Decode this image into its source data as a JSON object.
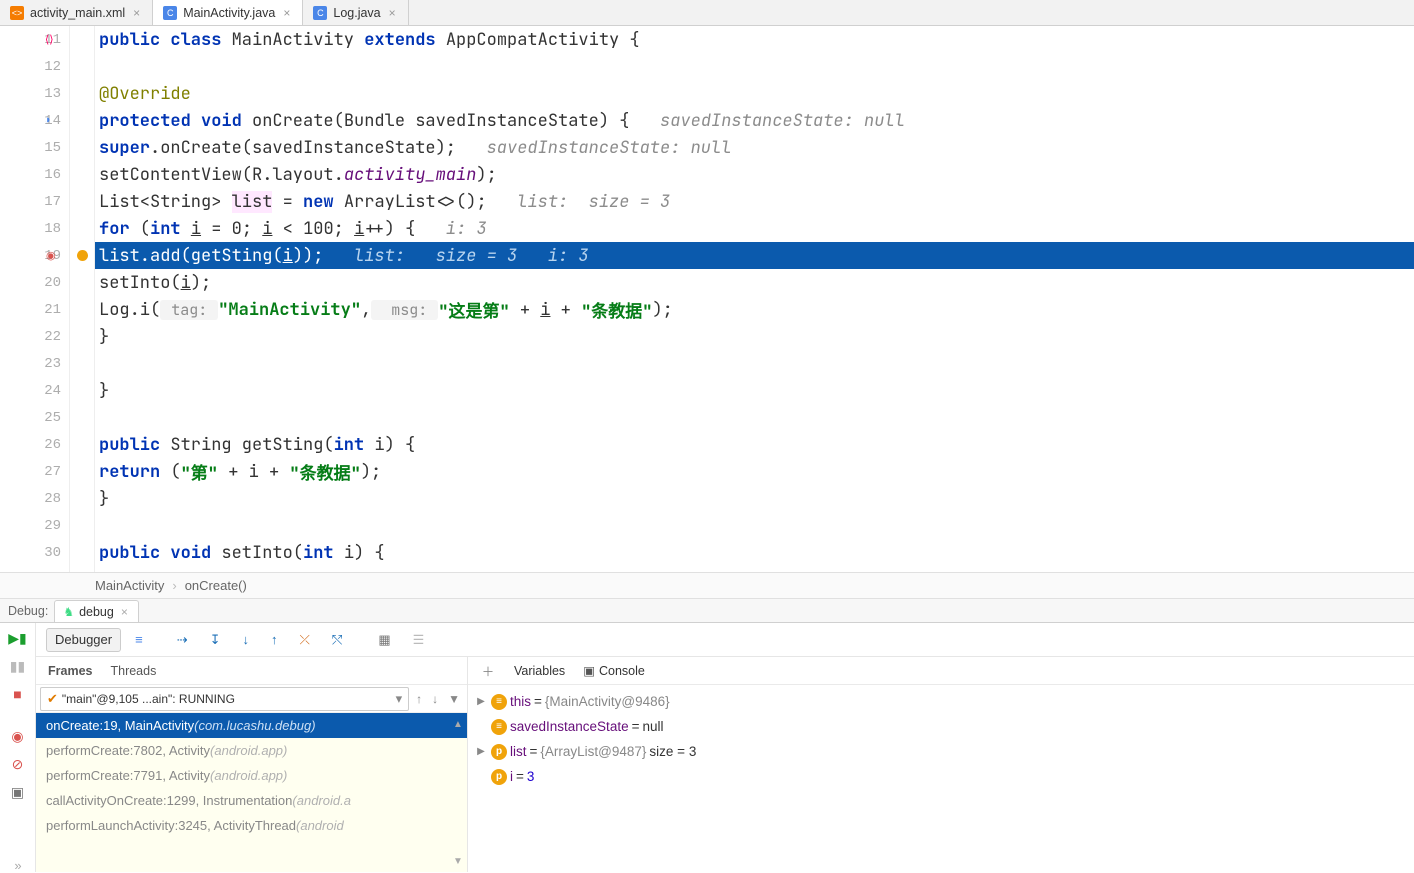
{
  "tabs": [
    {
      "name": "activity_main.xml",
      "icon": "xml"
    },
    {
      "name": "MainActivity.java",
      "icon": "java"
    },
    {
      "name": "Log.java",
      "icon": "java"
    }
  ],
  "activeTab": 1,
  "gutter": {
    "start": 11,
    "end": 30,
    "current": 19,
    "breakpoint": 19
  },
  "code": {
    "l11": {
      "k1": "public class",
      "c1": " MainActivity ",
      "k2": "extends",
      "c2": " AppCompatActivity {"
    },
    "l13": {
      "a": "@Override"
    },
    "l14": {
      "k1": "protected void",
      "m": " onCreate",
      "p": "(Bundle savedInstanceState) {",
      "h": "   savedInstanceState: null"
    },
    "l15": {
      "k": "super",
      "c": ".onCreate(savedInstanceState);",
      "h": "   savedInstanceState: null"
    },
    "l16": {
      "c": "setContentView(R.layout.",
      "f": "activity_main",
      "e": ");"
    },
    "l17": {
      "c1": "List<String> ",
      "v": "list",
      "c2": " = ",
      "k": "new",
      "c3": " ArrayList<>();",
      "h": "   list:  size = 3"
    },
    "l18": {
      "k1": "for",
      "c1": " (",
      "k2": "int",
      "c2": " ",
      "u": "i",
      "c3": " = ",
      "n": "0",
      "c4": "; ",
      "u2": "i",
      "c5": " < ",
      "n2": "100",
      "c6": "; ",
      "u3": "i",
      "c7": "++) {",
      "h": "   i: 3"
    },
    "l19": {
      "c": "list.add(getSting(",
      "u": "i",
      "e": "));",
      "h1": "   list:",
      "h2": "   size = 3",
      "h3": "   i: 3"
    },
    "l20": {
      "c": "setInto(",
      "u": "i",
      "e": ");"
    },
    "l21": {
      "c": "Log.i(",
      "t1": " tag: ",
      "s1": "\"MainActivity\"",
      "c2": ",",
      "t2": "  msg: ",
      "s2": "\"这是第\"",
      "c3": " + ",
      "u": "i",
      "c4": " + ",
      "s3": "\"条教据\"",
      "e": ");"
    },
    "l22": {
      "c": "}"
    },
    "l24": {
      "c": "}"
    },
    "l26": {
      "k1": "public",
      "c1": " String getSting(",
      "k2": "int",
      "c2": " i) {"
    },
    "l27": {
      "k": "return",
      "c1": " (",
      "s1": "\"第\"",
      "c2": " + i + ",
      "s2": "\"条教据\"",
      "c3": ");"
    },
    "l28": {
      "c": "}"
    },
    "l30": {
      "k1": "public void",
      "c1": " setInto(",
      "k2": "int",
      "c2": " i) {"
    }
  },
  "breadcrumb": {
    "a": "MainActivity",
    "b": "onCreate()"
  },
  "debug": {
    "title": "Debug:",
    "config": "debug",
    "debuggerTab": "Debugger",
    "framesTab": "Frames",
    "threadsTab": "Threads",
    "variablesTab": "Variables",
    "consoleTab": "Console",
    "thread": "\"main\"@9,105 ...ain\": RUNNING",
    "stack": [
      {
        "m": "onCreate:19, MainActivity ",
        "p": "(com.lucashu.debug)"
      },
      {
        "m": "performCreate:7802, Activity ",
        "p": "(android.app)"
      },
      {
        "m": "performCreate:7791, Activity ",
        "p": "(android.app)"
      },
      {
        "m": "callActivityOnCreate:1299, Instrumentation ",
        "p": "(android.a"
      },
      {
        "m": "performLaunchActivity:3245, ActivityThread ",
        "p": "(android"
      }
    ],
    "vars": {
      "v1": {
        "n": "this",
        "eq": " = ",
        "v": "{MainActivity@9486}"
      },
      "v2": {
        "n": "savedInstanceState",
        "eq": " = ",
        "v": "null"
      },
      "v3": {
        "n": "list",
        "eq": " = ",
        "v": "{ArrayList@9487} ",
        "s": " size = 3"
      },
      "v4": {
        "n": "i",
        "eq": " = ",
        "v": "3"
      }
    }
  }
}
